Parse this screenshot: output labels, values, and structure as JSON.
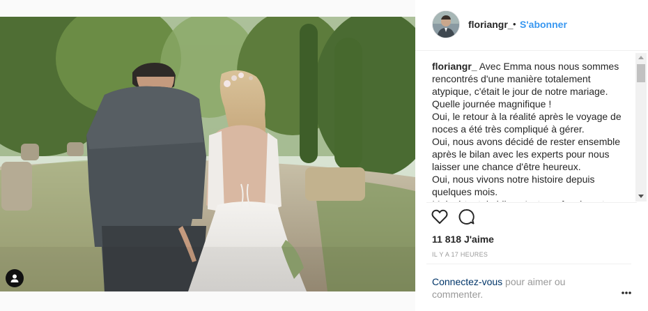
{
  "post": {
    "username": "floriangr_",
    "separator": "•",
    "follow_label": "S'abonner",
    "caption_user": "floriangr_",
    "caption_text": "Avec Emma nous nous sommes rencontrés d'une manière totalement atypique, c'était le jour de notre mariage.\nQuelle journée magnifique !\nOui, le retour à la réalité après le voyage de noces a été très compliqué à gérer.\nOui, nous avons décidé de rester ensemble après le bilan avec les experts pour nous laisser une chance d'être heureux.\nOui, nous vivons notre histoire depuis quelques mois.\nMalgré tout, le bilan n'est pas forcément",
    "likes": "11 818 J'aime",
    "timestamp": "IL Y A 17 HEURES",
    "login_link": "Connectez-vous",
    "login_rest": " pour aimer ou commenter."
  },
  "icons": {
    "tag": "person-tag-icon",
    "like": "heart-icon",
    "comment": "comment-bubble-icon",
    "more": "more-options-icon"
  },
  "colors": {
    "link": "#3897f0",
    "login_link": "#003569",
    "muted": "#999999",
    "text": "#262626"
  }
}
